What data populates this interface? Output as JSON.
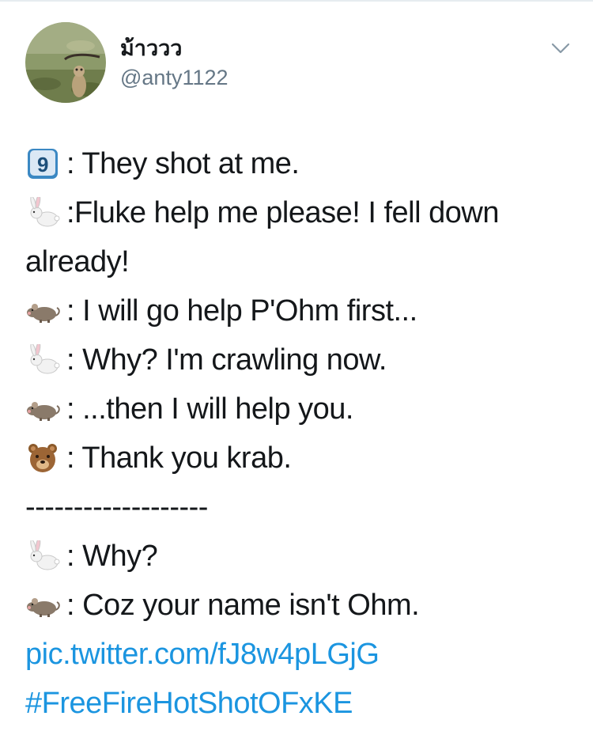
{
  "user": {
    "display_name": "ม้าววว",
    "handle": "@anty1122",
    "avatar": "avatar-photo"
  },
  "icons": {
    "menu": "chevron-down-icon",
    "nine": "keycap-nine-emoji",
    "rabbit": "rabbit-emoji",
    "rat": "rat-emoji",
    "bear": "bear-face-emoji"
  },
  "tweet": {
    "l1": ": They shot at me.",
    "l2": ":Fluke help me please! I fell down already!",
    "l3": ": I will go help P'Ohm first...",
    "l4": ": Why? I'm crawling now.",
    "l5": ": ...then I will help you.",
    "l6": ": Thank you krab.",
    "divider": "-------------------",
    "l7": ": Why?",
    "l8": ": Coz your name isn't Ohm.",
    "link": "pic.twitter.com/fJ8w4pLGjG",
    "hashtag": "#FreeFireHotShotOFxKE"
  },
  "colors": {
    "text": "#14171a",
    "secondary": "#657786",
    "link": "#1b95e0"
  }
}
